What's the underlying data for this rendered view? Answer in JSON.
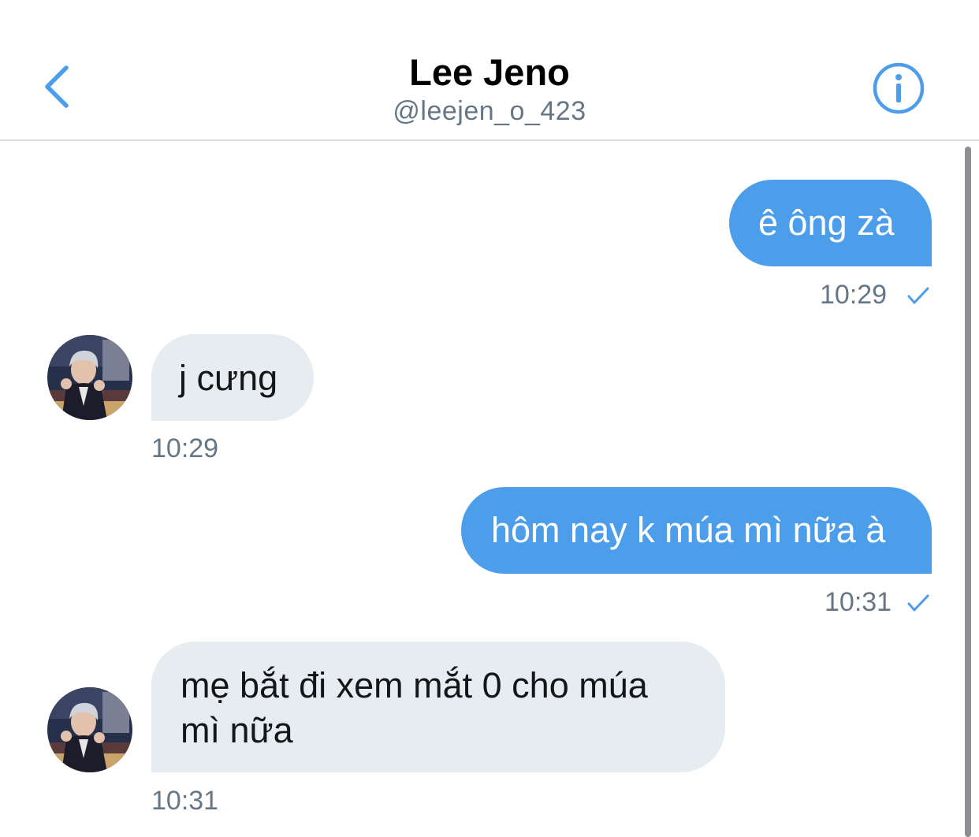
{
  "header": {
    "name": "Lee Jeno",
    "handle": "@leejen_o_423"
  },
  "colors": {
    "accent": "#4c9eeb",
    "received_bubble": "#e6ecf0",
    "timestamp": "#657786"
  },
  "messages": [
    {
      "direction": "sent",
      "text": "ê ông zà",
      "time": "10:29",
      "status": "sent-check"
    },
    {
      "direction": "received",
      "text": "j cưng",
      "time": "10:29"
    },
    {
      "direction": "sent",
      "text": "hôm nay k múa mì nữa à",
      "time": "10:31",
      "status": "sent-check"
    },
    {
      "direction": "received",
      "line1": "mẹ bắt đi xem mắt 0 cho múa",
      "line2": "mì nữa",
      "time": "10:31"
    }
  ]
}
